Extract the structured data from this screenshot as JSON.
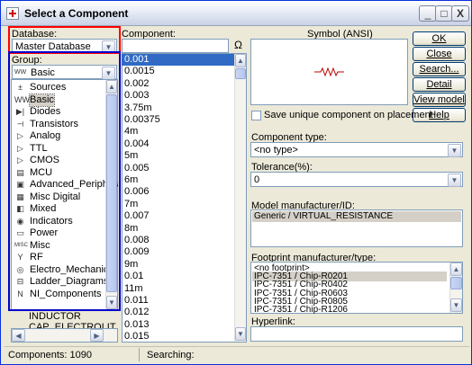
{
  "window": {
    "title": "Select a Component",
    "btn_min": "_",
    "btn_max": "□",
    "btn_close": "X"
  },
  "database": {
    "label": "Database:",
    "value": "Master Database"
  },
  "group": {
    "label": "Group:",
    "value": "Basic",
    "items": [
      {
        "icon": "sources-icon",
        "glyph": "±",
        "label": "Sources"
      },
      {
        "icon": "basic-icon",
        "glyph": "WW",
        "label": "Basic"
      },
      {
        "icon": "diodes-icon",
        "glyph": "▶|",
        "label": "Diodes"
      },
      {
        "icon": "transistors-icon",
        "glyph": "⊣",
        "label": "Transistors"
      },
      {
        "icon": "analog-icon",
        "glyph": "▷",
        "label": "Analog"
      },
      {
        "icon": "ttl-icon",
        "glyph": "▷",
        "label": "TTL"
      },
      {
        "icon": "cmos-icon",
        "glyph": "▷",
        "label": "CMOS"
      },
      {
        "icon": "mcu-icon",
        "glyph": "▤",
        "label": "MCU"
      },
      {
        "icon": "advanced-peripherals-icon",
        "glyph": "▣",
        "label": "Advanced_Peripherals"
      },
      {
        "icon": "misc-digital-icon",
        "glyph": "▦",
        "label": "Misc Digital"
      },
      {
        "icon": "mixed-icon",
        "glyph": "◧",
        "label": "Mixed"
      },
      {
        "icon": "indicators-icon",
        "glyph": "◉",
        "label": "Indicators"
      },
      {
        "icon": "power-icon",
        "glyph": "▭",
        "label": "Power"
      },
      {
        "icon": "misc-icon",
        "glyph": "MISC",
        "label": "Misc"
      },
      {
        "icon": "rf-icon",
        "glyph": "Y",
        "label": "RF"
      },
      {
        "icon": "electro-mechanical-icon",
        "glyph": "◎",
        "label": "Electro_Mechanical"
      },
      {
        "icon": "ladder-diagrams-icon",
        "glyph": "⊟",
        "label": "Ladder_Diagrams"
      },
      {
        "icon": "ni-components-icon",
        "glyph": "N",
        "label": "NI_Components"
      }
    ],
    "behind_items": [
      "INDUCTOR",
      "CAP_ELECTROLIT"
    ]
  },
  "component": {
    "label": "Component:",
    "search_value": "",
    "search_icon": "Ω",
    "items": [
      "0.001",
      "0.0015",
      "0.002",
      "0.003",
      "3.75m",
      "0.00375",
      "4m",
      "0.004",
      "5m",
      "0.005",
      "6m",
      "0.006",
      "7m",
      "0.007",
      "8m",
      "0.008",
      "0.009",
      "9m",
      "0.01",
      "11m",
      "0.011",
      "0.012",
      "0.013",
      "0.015"
    ]
  },
  "symbol": {
    "label": "Symbol (ANSI)"
  },
  "buttons": {
    "ok": "OK",
    "close": "Close",
    "search": "Search...",
    "detail_report": "Detail report",
    "view_model": "View model",
    "help": "Help"
  },
  "save_unique": {
    "label": "Save unique component on placement",
    "checked": false
  },
  "component_type": {
    "label": "Component type:",
    "value": "<no type>"
  },
  "tolerance": {
    "label": "Tolerance(%):",
    "value": "0"
  },
  "model": {
    "label": "Model manufacturer/ID:",
    "value": "Generic / VIRTUAL_RESISTANCE"
  },
  "footprint": {
    "label": "Footprint manufacturer/type:",
    "items": [
      "<no footprint>",
      "IPC-7351 / Chip-R0201",
      "IPC-7351 / Chip-R0402",
      "IPC-7351 / Chip-R0603",
      "IPC-7351 / Chip-R0805",
      "IPC-7351 / Chip-R1206"
    ],
    "selected_index": 1
  },
  "hyperlink": {
    "label": "Hyperlink:",
    "value": ""
  },
  "status": {
    "components": "Components: 1090",
    "searching": "Searching:"
  },
  "colors": {
    "selection": "#316ac5",
    "highlight_red": "#ff0000",
    "highlight_blue": "#0000cc"
  }
}
